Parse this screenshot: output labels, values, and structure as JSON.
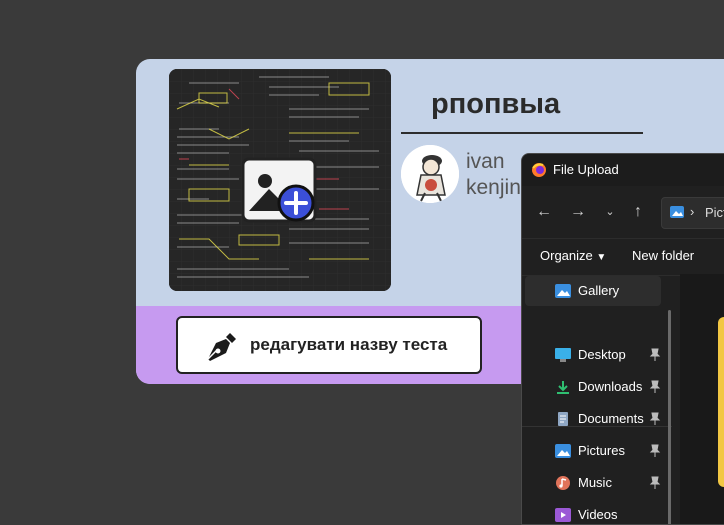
{
  "quiz": {
    "title": "рпопвыа",
    "author_first": "ivan",
    "author_second": "kenjin",
    "edit_button_label": "редагувати назву теста",
    "cover_alt_icon": "add-image-icon"
  },
  "file_dialog": {
    "title": "File Upload",
    "address": "Pict",
    "toolbar": {
      "organize": "Organize",
      "new_folder": "New folder"
    },
    "nav_items": [
      {
        "label": "Gallery",
        "icon": "gallery-icon",
        "pinned": false,
        "selected": true
      },
      {
        "label": "Desktop",
        "icon": "desktop-icon",
        "pinned": true
      },
      {
        "label": "Downloads",
        "icon": "downloads-icon",
        "pinned": true
      },
      {
        "label": "Documents",
        "icon": "documents-icon",
        "pinned": true
      },
      {
        "label": "Pictures",
        "icon": "pictures-icon",
        "pinned": true
      },
      {
        "label": "Music",
        "icon": "music-icon",
        "pinned": true
      },
      {
        "label": "Videos",
        "icon": "videos-icon",
        "pinned": true
      }
    ]
  },
  "colors": {
    "page_bg": "#3a3a3a",
    "card_top": "#c5d3e8",
    "card_bottom": "#c69af0",
    "dialog_bg": "#202020",
    "add_badge": "#3b4fd8"
  }
}
